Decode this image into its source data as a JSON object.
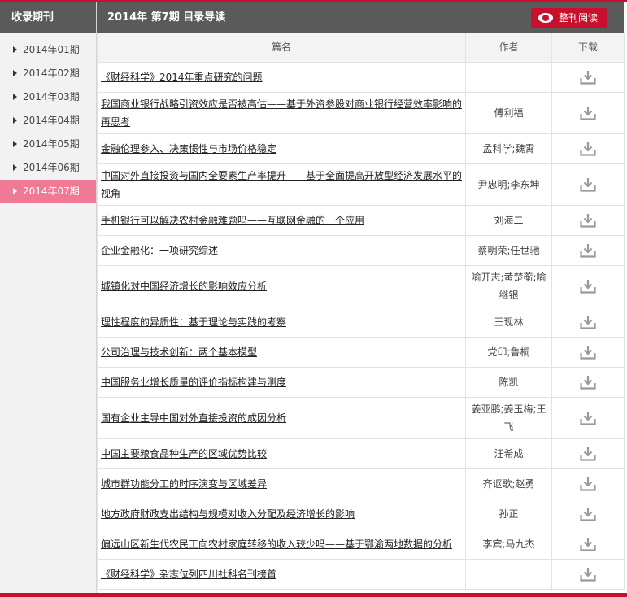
{
  "sidebar": {
    "title": "收录期刊",
    "items": [
      {
        "label": "2014年01期"
      },
      {
        "label": "2014年02期"
      },
      {
        "label": "2014年03期"
      },
      {
        "label": "2014年04期"
      },
      {
        "label": "2014年05期"
      },
      {
        "label": "2014年06期"
      },
      {
        "label": "2014年07期",
        "active": true
      }
    ]
  },
  "header": {
    "title": "2014年 第7期 目录导读",
    "read_button": "整刊阅读"
  },
  "table": {
    "columns": [
      "篇名",
      "作者",
      "下载"
    ],
    "rows": [
      {
        "title": "《财经科学》2014年重点研究的问题",
        "author": "",
        "tall": false
      },
      {
        "title": "我国商业银行战略引资效应是否被高估——基于外资参股对商业银行经营效率影响的再思考",
        "author": "傅利福",
        "tall": true
      },
      {
        "title": "金融伦理参入、决策惯性与市场价格稳定",
        "author": "孟科学;魏霄",
        "tall": false
      },
      {
        "title": "中国对外直接投资与国内全要素生产率提升——基于全面提高开放型经济发展水平的视角",
        "author": "尹忠明;李东坤",
        "tall": true
      },
      {
        "title": "手机银行可以解决农村金融难题吗——互联网金融的一个应用",
        "author": "刘海二",
        "tall": false
      },
      {
        "title": "企业金融化：一项研究综述",
        "author": "蔡明荣;任世驰",
        "tall": false
      },
      {
        "title": "城镇化对中国经济增长的影响效应分析",
        "author": "喻开志;黄楚蘅;喻继银",
        "tall": true
      },
      {
        "title": "理性程度的异质性：基于理论与实践的考察",
        "author": "王现林",
        "tall": false
      },
      {
        "title": "公司治理与技术创新：两个基本模型",
        "author": "党印;鲁桐",
        "tall": false
      },
      {
        "title": "中国服务业增长质量的评价指标构建与测度",
        "author": "陈凯",
        "tall": false
      },
      {
        "title": "国有企业主导中国对外直接投资的成因分析",
        "author": "姜亚鹏;姜玉梅;王飞",
        "tall": true
      },
      {
        "title": "中国主要粮食品种生产的区域优势比较",
        "author": "汪希成",
        "tall": false
      },
      {
        "title": "城市群功能分工的时序演变与区域差异",
        "author": "齐讴歌;赵勇",
        "tall": false
      },
      {
        "title": "地方政府财政支出结构与规模对收入分配及经济增长的影响",
        "author": "孙正",
        "tall": false
      },
      {
        "title": "偏远山区新生代农民工向农村家庭转移的收入较少吗——基于鄂渝两地数据的分析",
        "author": "李宾;马九杰",
        "tall": false
      },
      {
        "title": "《财经科学》杂志位列四川社科名刊榜首",
        "author": "",
        "tall": false
      }
    ]
  },
  "colors": {
    "accent": "#c8102e",
    "active_item": "#f07a96",
    "header_bg": "#5a5a5a"
  }
}
